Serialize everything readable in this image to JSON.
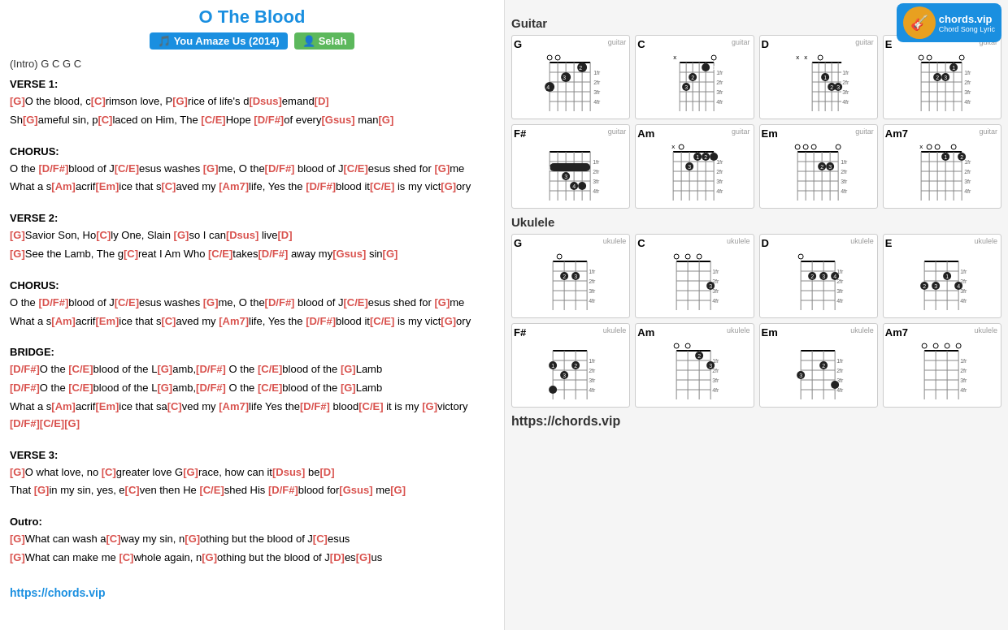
{
  "header": {
    "title": "O The Blood",
    "badge_album": "You Amaze Us (2014)",
    "badge_artist": "Selah",
    "logo_text": "chords.vip",
    "logo_sub": "Chord Song Lyric"
  },
  "intro": "(Intro) G C G C",
  "sections": [
    {
      "label": "VERSE 1:",
      "lines": [
        {
          "parts": [
            {
              "chord": "G",
              "text": "O the blood, c"
            },
            {
              "chord": "C",
              "text": "rimson love, P"
            },
            {
              "chord": "G",
              "text": "rice of life's d"
            },
            {
              "chord": "Dsus",
              "text": "emand"
            },
            {
              "chord": "D",
              "text": ""
            }
          ]
        },
        {
          "parts": [
            {
              "chord": "",
              "text": "Sh"
            },
            {
              "chord": "G",
              "text": "ameful sin, p"
            },
            {
              "chord": "C",
              "text": "laced on Him, The "
            },
            {
              "chord": "C/E",
              "text": "Hope "
            },
            {
              "chord": "D/F#",
              "text": "of every"
            },
            {
              "chord": "Gsus",
              "text": " man"
            },
            {
              "chord": "G",
              "text": ""
            }
          ]
        }
      ]
    },
    {
      "label": "CHORUS:",
      "lines": [
        {
          "parts": [
            {
              "chord": "",
              "text": "O the "
            },
            {
              "chord": "D/F#",
              "text": "blood of J"
            },
            {
              "chord": "C/E",
              "text": "esus washes "
            },
            {
              "chord": "G",
              "text": "me, O the"
            },
            {
              "chord": "D/F#",
              "text": " blood of J"
            },
            {
              "chord": "C/E",
              "text": "esus shed for "
            },
            {
              "chord": "G",
              "text": "me"
            }
          ]
        },
        {
          "parts": [
            {
              "chord": "",
              "text": "What a s"
            },
            {
              "chord": "Am",
              "text": "acrif"
            },
            {
              "chord": "Em",
              "text": "ice that s"
            },
            {
              "chord": "C",
              "text": "aved my "
            },
            {
              "chord": "Am7",
              "text": "life, Yes the "
            },
            {
              "chord": "D/F#",
              "text": "blood it"
            },
            {
              "chord": "C/E",
              "text": " is my vict"
            },
            {
              "chord": "G",
              "text": "ory"
            }
          ]
        }
      ]
    },
    {
      "label": "VERSE 2:",
      "lines": [
        {
          "parts": [
            {
              "chord": "G",
              "text": "Savior Son, Ho"
            },
            {
              "chord": "C",
              "text": "ly One, Slain "
            },
            {
              "chord": "G",
              "text": "so I can"
            },
            {
              "chord": "Dsus",
              "text": " live"
            },
            {
              "chord": "D",
              "text": ""
            }
          ]
        },
        {
          "parts": [
            {
              "chord": "G",
              "text": "See the Lamb, The g"
            },
            {
              "chord": "C",
              "text": "reat I Am Who "
            },
            {
              "chord": "C/E",
              "text": "takes"
            },
            {
              "chord": "D/F#",
              "text": " away my"
            },
            {
              "chord": "Gsus",
              "text": " sin"
            },
            {
              "chord": "G",
              "text": ""
            }
          ]
        }
      ]
    },
    {
      "label": "CHORUS:",
      "lines": [
        {
          "parts": [
            {
              "chord": "",
              "text": "O the "
            },
            {
              "chord": "D/F#",
              "text": "blood of J"
            },
            {
              "chord": "C/E",
              "text": "esus washes "
            },
            {
              "chord": "G",
              "text": "me, O the"
            },
            {
              "chord": "D/F#",
              "text": " blood of J"
            },
            {
              "chord": "C/E",
              "text": "esus shed for "
            },
            {
              "chord": "G",
              "text": "me"
            }
          ]
        },
        {
          "parts": [
            {
              "chord": "",
              "text": "What a s"
            },
            {
              "chord": "Am",
              "text": "acrif"
            },
            {
              "chord": "Em",
              "text": "ice that s"
            },
            {
              "chord": "C",
              "text": "aved my "
            },
            {
              "chord": "Am7",
              "text": "life, Yes the "
            },
            {
              "chord": "D/F#",
              "text": "blood it"
            },
            {
              "chord": "C/E",
              "text": " is my vict"
            },
            {
              "chord": "G",
              "text": "ory"
            }
          ]
        }
      ]
    },
    {
      "label": "BRIDGE:",
      "lines": [
        {
          "parts": [
            {
              "chord": "D/F#",
              "text": "O the "
            },
            {
              "chord": "C/E",
              "text": "blood of the L"
            },
            {
              "chord": "G",
              "text": "amb,"
            },
            {
              "chord": "D/F#",
              "text": " O the "
            },
            {
              "chord": "C/E",
              "text": "blood of the "
            },
            {
              "chord": "G",
              "text": "Lamb"
            }
          ]
        },
        {
          "parts": [
            {
              "chord": "D/F#",
              "text": "O the "
            },
            {
              "chord": "C/E",
              "text": "blood of the L"
            },
            {
              "chord": "G",
              "text": "amb,"
            },
            {
              "chord": "D/F#",
              "text": " O the "
            },
            {
              "chord": "C/E",
              "text": "blood of the "
            },
            {
              "chord": "G",
              "text": "Lamb"
            }
          ]
        },
        {
          "parts": [
            {
              "chord": "",
              "text": "What a s"
            },
            {
              "chord": "Am",
              "text": "acrif"
            },
            {
              "chord": "Em",
              "text": "ice that sa"
            },
            {
              "chord": "C",
              "text": "ved my "
            },
            {
              "chord": "Am7",
              "text": "life Yes the"
            },
            {
              "chord": "D/F#",
              "text": " blood"
            },
            {
              "chord": "C/E",
              "text": " it is my "
            },
            {
              "chord": "G",
              "text": "victory "
            },
            {
              "chord": "D/F#",
              "text": ""
            },
            {
              "chord": "C/E",
              "text": ""
            },
            {
              "chord": "G",
              "text": ""
            }
          ]
        }
      ]
    },
    {
      "label": "VERSE 3:",
      "lines": [
        {
          "parts": [
            {
              "chord": "G",
              "text": "O what love, no "
            },
            {
              "chord": "C",
              "text": "greater love G"
            },
            {
              "chord": "G",
              "text": "race, how can it"
            },
            {
              "chord": "Dsus",
              "text": " be"
            },
            {
              "chord": "D",
              "text": ""
            }
          ]
        },
        {
          "parts": [
            {
              "chord": "",
              "text": "That "
            },
            {
              "chord": "G",
              "text": "in my sin, yes, e"
            },
            {
              "chord": "C",
              "text": "ven then He "
            },
            {
              "chord": "C/E",
              "text": "shed His "
            },
            {
              "chord": "D/F#",
              "text": "blood for"
            },
            {
              "chord": "Gsus",
              "text": " me"
            },
            {
              "chord": "G",
              "text": ""
            }
          ]
        }
      ]
    },
    {
      "label": "Outro:",
      "lines": [
        {
          "parts": [
            {
              "chord": "G",
              "text": "What can wash a"
            },
            {
              "chord": "C",
              "text": "way my sin, n"
            },
            {
              "chord": "G",
              "text": "othing but the blood of J"
            },
            {
              "chord": "C",
              "text": "esus"
            }
          ]
        },
        {
          "parts": [
            {
              "chord": "G",
              "text": "What can make me "
            },
            {
              "chord": "C",
              "text": "whole again, n"
            },
            {
              "chord": "G",
              "text": "othing but the blood of J"
            },
            {
              "chord": "D",
              "text": "es"
            },
            {
              "chord": "G",
              "text": "us"
            }
          ]
        }
      ]
    }
  ],
  "footer_url": "https://chords.vip",
  "right": {
    "guitar_label": "Guitar",
    "ukulele_label": "Ukulele",
    "site_url": "https://chords.vip",
    "chords_guitar": [
      {
        "name": "G",
        "type": "guitar"
      },
      {
        "name": "C",
        "type": "guitar"
      },
      {
        "name": "D",
        "type": "guitar"
      },
      {
        "name": "E",
        "type": "guitar"
      },
      {
        "name": "F#",
        "type": "guitar"
      },
      {
        "name": "Am",
        "type": "guitar"
      },
      {
        "name": "Em",
        "type": "guitar"
      },
      {
        "name": "Am7",
        "type": "guitar"
      }
    ],
    "chords_ukulele": [
      {
        "name": "G",
        "type": "ukulele"
      },
      {
        "name": "C",
        "type": "ukulele"
      },
      {
        "name": "D",
        "type": "ukulele"
      },
      {
        "name": "E",
        "type": "ukulele"
      },
      {
        "name": "F#",
        "type": "ukulele"
      },
      {
        "name": "Am",
        "type": "ukulele"
      },
      {
        "name": "Em",
        "type": "ukulele"
      },
      {
        "name": "Am7",
        "type": "ukulele"
      }
    ]
  }
}
